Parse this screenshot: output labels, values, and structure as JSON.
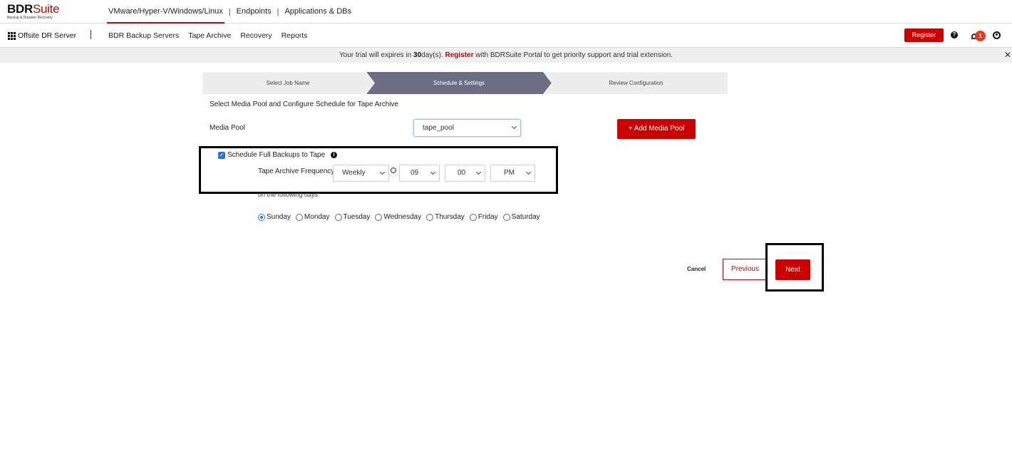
{
  "brand": {
    "name_main": "BDR",
    "name_accent": "Suite",
    "tagline": "Backup & Disaster Recovery"
  },
  "product_nav": [
    "VMware/Hyper-V/Windows/Linux",
    "Endpoints",
    "Applications & DBs"
  ],
  "product_nav_separator": "|",
  "server": {
    "label": "Offsite DR Server"
  },
  "menu": [
    "BDR Backup Servers",
    "Tape Archive",
    "Recovery",
    "Reports"
  ],
  "header_actions": {
    "register_label": "Register",
    "help": "?",
    "notification_count": "1"
  },
  "trial_banner": {
    "prefix": "Your trial will expires in",
    "days": "30",
    "days_suffix": "day(s).",
    "register_link": "Register",
    "suffix": "with BDRSuite Portal to get priority support and trial extension.",
    "close": "✕"
  },
  "wizard": {
    "steps": [
      "Select Job Name",
      "Schedule & Settings",
      "Review Configuration"
    ],
    "active_step": 2
  },
  "form": {
    "section_title": "Select Media Pool and Configure Schedule for Tape Archive",
    "media_pool_label": "Media Pool",
    "media_pool_value": "tape_pool",
    "add_media_pool_label": "+ Add Media Pool",
    "schedule_checkbox_label": "Schedule Full Backups to Tape",
    "schedule_checked": true,
    "info": "i",
    "frequency_label": "Tape Archive Frequency",
    "frequency_value": "Weekly",
    "hour_value": "09",
    "minute_value": "00",
    "ampm_value": "PM",
    "days_label": "on the following days:",
    "days": [
      "Sunday",
      "Monday",
      "Tuesday",
      "Wednesday",
      "Thursday",
      "Friday",
      "Saturday"
    ],
    "selected_day": "Sunday"
  },
  "footer": {
    "cancel_label": "Cancel",
    "previous_label": "Previous",
    "next_label": "Next"
  },
  "colors": {
    "brand_red": "#cc0000",
    "step_active": "#6b6e85",
    "radio_blue": "#2d72d9"
  }
}
